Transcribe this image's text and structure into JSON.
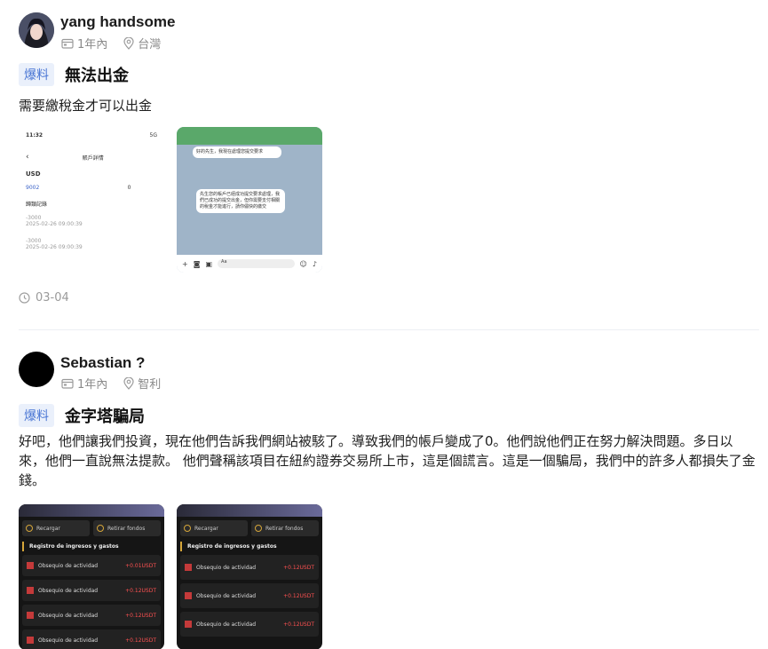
{
  "posts": [
    {
      "username": "yang handsome",
      "time": "1年內",
      "location": "台灣",
      "tag": "爆料",
      "title": "無法出金",
      "body": "需要繳稅金才可以出金",
      "date": "03-04",
      "screenshot1": {
        "time": "11:32",
        "signal": "5G",
        "heading": "賬戶詳情",
        "currency": "USD",
        "value_a": "9002",
        "value_b": "0",
        "section": "歸類記錄",
        "entry1_amount": "-3000",
        "entry1_date": "2025-02-26 09:00:39",
        "entry2_amount": "-3000",
        "entry2_date": "2025-02-26 09:00:39"
      },
      "screenshot2": {
        "bubble1": "好的先生，我現在處理您提交要求",
        "bubble2": "先生您的帳戶已經成功提交要求處理，我們已成功的提交出金，但你需要支付相關的稅金才能進行，請你儘快的繳交",
        "input_placeholder": "Aa"
      }
    },
    {
      "username": "Sebastian ?",
      "time": "1年內",
      "location": "智利",
      "tag": "爆料",
      "title": "金字塔騙局",
      "body": "好吧，他們讓我們投資，現在他們告訴我們網站被駭了。導致我們的帳戶變成了0。他們說他們正在努力解決問題。多日以來，他們一直說無法提款。 他們聲稱該項目在紐約證券交易所上市，這是個謊言。這是一個騙局，我們中的許多人都損失了金錢。",
      "screenshot_left": {
        "btn1": "Recargar",
        "btn2": "Retirar fondos",
        "section": "Registro de ingresos y gastos",
        "entries": [
          {
            "desc": "Obsequio de actividad",
            "amount": "+0.01USDT"
          },
          {
            "desc": "Obsequio de actividad",
            "amount": "+0.12USDT"
          },
          {
            "desc": "Obsequio de actividad",
            "amount": "+0.12USDT"
          },
          {
            "desc": "Obsequio de actividad",
            "amount": "+0.12USDT"
          }
        ]
      },
      "screenshot_right": {
        "btn1": "Recargar",
        "btn2": "Retirar fondos",
        "section": "Registro de ingresos y gastos",
        "entries": [
          {
            "desc": "Obsequio de actividad",
            "amount": "+0.12USDT"
          },
          {
            "desc": "Obsequio de actividad",
            "amount": "+0.12USDT"
          },
          {
            "desc": "Obsequio de actividad",
            "amount": "+0.12USDT"
          }
        ]
      }
    }
  ],
  "icons": {
    "time": "calendar-icon",
    "location": "location-pin-icon",
    "date": "clock-icon"
  },
  "colors": {
    "tag_bg": "#eaf0fb",
    "tag_text": "#4a76d4",
    "meta_text": "#8a8a8a"
  }
}
